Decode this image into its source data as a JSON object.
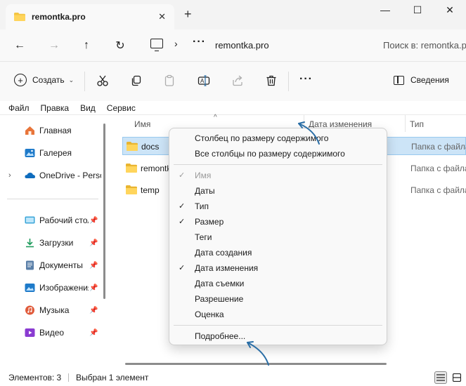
{
  "window": {
    "tab_title": "remontka.pro",
    "new_tab": "+",
    "minimize": "—",
    "maximize": "☐",
    "close": "✕"
  },
  "nav": {
    "back": "←",
    "forward": "→",
    "up": "↑",
    "refresh": "↻",
    "breadcrumb_chevron": "›",
    "breadcrumb_more": "···",
    "address": "remontka.pro",
    "search_placeholder": "Поиск в: remontka.pro"
  },
  "toolbar": {
    "create_label": "Создать",
    "more": "···",
    "details_label": "Сведения",
    "icons": [
      "cut-icon",
      "copy-icon",
      "paste-icon",
      "rename-icon",
      "share-icon",
      "delete-icon"
    ]
  },
  "menubar": [
    "Файл",
    "Правка",
    "Вид",
    "Сервис"
  ],
  "sidebar": {
    "items": [
      {
        "label": "Главная",
        "icon": "home-icon",
        "expand": ""
      },
      {
        "label": "Галерея",
        "icon": "gallery-icon",
        "expand": ""
      },
      {
        "label": "OneDrive - Personal",
        "icon": "onedrive-icon",
        "expand": "›"
      },
      {
        "label": "Рабочий стол",
        "icon": "desktop-icon",
        "pinned": true
      },
      {
        "label": "Загрузки",
        "icon": "downloads-icon",
        "pinned": true
      },
      {
        "label": "Документы",
        "icon": "documents-icon",
        "pinned": true
      },
      {
        "label": "Изображения",
        "icon": "pictures-icon",
        "pinned": true
      },
      {
        "label": "Музыка",
        "icon": "music-icon",
        "pinned": true
      },
      {
        "label": "Видео",
        "icon": "videos-icon",
        "pinned": true
      }
    ],
    "pin_glyph": "📌"
  },
  "columns": {
    "name": "Имя",
    "date": "Дата изменения",
    "type": "Тип",
    "sort_caret": "^"
  },
  "files": [
    {
      "name": "docs",
      "type": "Папка с файлами",
      "selected": true
    },
    {
      "name": "remontka",
      "type": "Папка с файлами",
      "selected": false
    },
    {
      "name": "temp",
      "type": "Папка с файлами",
      "selected": false
    }
  ],
  "context_menu": {
    "top_items": [
      "Столбец по размеру содержимого",
      "Все столбцы по размеру содержимого"
    ],
    "columns": [
      {
        "label": "Имя",
        "checked": true,
        "disabled": true
      },
      {
        "label": "Даты",
        "checked": false
      },
      {
        "label": "Тип",
        "checked": true
      },
      {
        "label": "Размер",
        "checked": true
      },
      {
        "label": "Теги",
        "checked": false
      },
      {
        "label": "Дата создания",
        "checked": false
      },
      {
        "label": "Дата изменения",
        "checked": true
      },
      {
        "label": "Дата съемки",
        "checked": false
      },
      {
        "label": "Разрешение",
        "checked": false
      },
      {
        "label": "Оценка",
        "checked": false
      }
    ],
    "more": "Подробнее...",
    "check_glyph": "✓"
  },
  "status": {
    "item_count": "Элементов: 3",
    "selected": "Выбран 1 элемент"
  },
  "colors": {
    "selection_bg": "#cce4f7",
    "annotation_arrow": "#2a6ea6",
    "folder_yellow": "#f4c542"
  }
}
